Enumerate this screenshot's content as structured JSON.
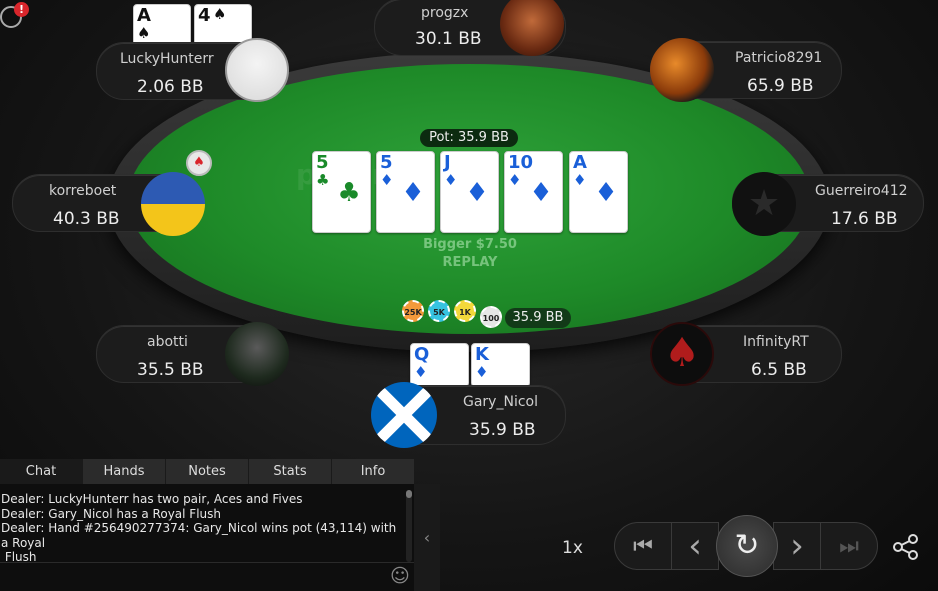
{
  "table": {
    "pot_label": "Pot: 35.9 BB",
    "replay_bigger": "Bigger $7.50",
    "replay_label": "REPLAY",
    "felt_logo": "poker"
  },
  "board": [
    {
      "rank": "5",
      "suit": "♣",
      "color": "#1a8a2a"
    },
    {
      "rank": "5",
      "suit": "♦",
      "color": "#1a5fd8"
    },
    {
      "rank": "J",
      "suit": "♦",
      "color": "#1a5fd8"
    },
    {
      "rank": "10",
      "suit": "♦",
      "color": "#1a5fd8"
    },
    {
      "rank": "A",
      "suit": "♦",
      "color": "#1a5fd8"
    }
  ],
  "players": {
    "progzx": {
      "name": "progzx",
      "stack": "30.1 BB"
    },
    "luckyhunterr": {
      "name": "LuckyHunterr",
      "stack": "2.06 BB",
      "cards": [
        {
          "rank": "A",
          "suit": "♠"
        },
        {
          "rank": "4",
          "suit": "♠"
        }
      ]
    },
    "patricio": {
      "name": "Patricio8291",
      "stack": "65.9 BB"
    },
    "korreboet": {
      "name": "korreboet",
      "stack": "40.3 BB"
    },
    "guerreiro": {
      "name": "Guerreiro412",
      "stack": "17.6 BB"
    },
    "abotti": {
      "name": "abotti",
      "stack": "35.5 BB"
    },
    "infinity": {
      "name": "InfinityRT",
      "stack": "6.5 BB"
    },
    "gary": {
      "name": "Gary_Nicol",
      "stack": "35.9 BB",
      "cards": [
        {
          "rank": "Q",
          "suit": "♦"
        },
        {
          "rank": "K",
          "suit": "♦"
        }
      ]
    }
  },
  "chips": {
    "labels": [
      "25K",
      "5K",
      "1K",
      "100"
    ],
    "amount": "35.9 BB"
  },
  "tabs": [
    "Chat",
    "Hands",
    "Notes",
    "Stats",
    "Info"
  ],
  "chat": [
    "Dealer: LuckyHunterr has two pair, Aces and Fives",
    "Dealer: Gary_Nicol has a Royal Flush",
    "Dealer: Hand #256490277374: Gary_Nicol wins pot (43,114) with a Royal",
    " Flush"
  ],
  "playback": {
    "speed": "1x"
  },
  "icons": {
    "first": "⏮",
    "prev": "‹",
    "replay": "↻",
    "next": "›",
    "last": "⏭",
    "share": "share-icon",
    "emoji": "☺"
  }
}
